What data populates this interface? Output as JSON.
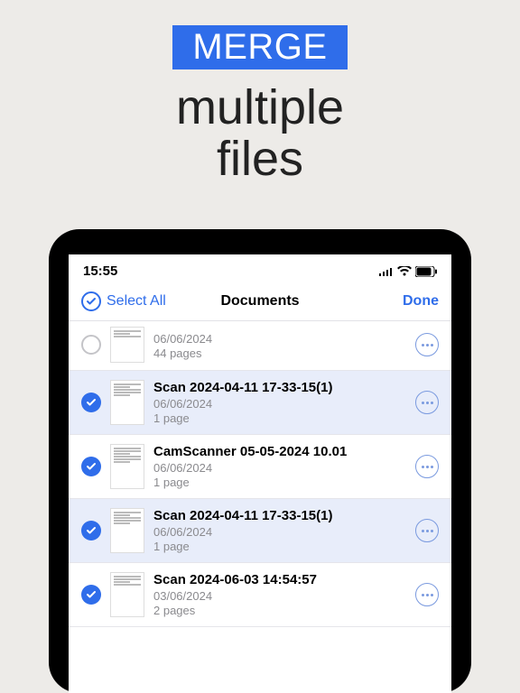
{
  "hero": {
    "badge": "MERGE",
    "line1": "multiple",
    "line2": "files"
  },
  "statusbar": {
    "time": "15:55"
  },
  "toolbar": {
    "selectAll": "Select All",
    "title": "Documents",
    "done": "Done"
  },
  "rows": [
    {
      "selected": false,
      "title": "",
      "date": "06/06/2024",
      "pages": "44 pages"
    },
    {
      "selected": true,
      "title": "Scan 2024-04-11 17-33-15(1)",
      "date": "06/06/2024",
      "pages": "1 page"
    },
    {
      "selected": true,
      "title": "CamScanner 05-05-2024 10.01",
      "date": "06/06/2024",
      "pages": "1 page"
    },
    {
      "selected": true,
      "title": "Scan 2024-04-11 17-33-15(1)",
      "date": "06/06/2024",
      "pages": "1 page"
    },
    {
      "selected": true,
      "title": "Scan 2024-06-03 14:54:57",
      "date": "03/06/2024",
      "pages": "2 pages"
    }
  ]
}
